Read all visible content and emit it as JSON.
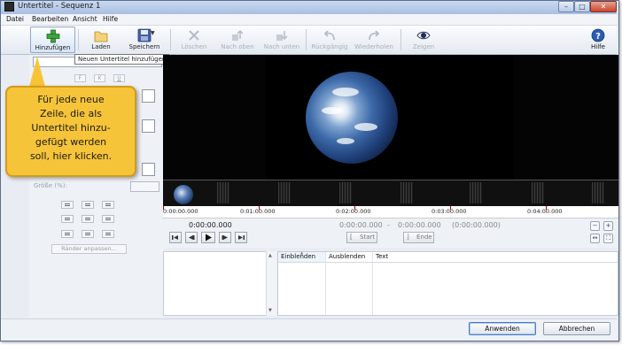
{
  "window": {
    "title": "Untertitel - Sequenz 1",
    "controls": {
      "minimize": "–",
      "maximize": "□",
      "close": "✕"
    }
  },
  "menu": [
    "Datei",
    "Bearbeiten",
    "Ansicht",
    "Hilfe"
  ],
  "toolbar": {
    "add": "Hinzufügen",
    "load": "Laden",
    "save": "Speichern",
    "delete": "Löschen",
    "move_up": "Nach oben",
    "move_down": "Nach unten",
    "undo": "Rückgängig",
    "redo": "Wiederholen",
    "show": "Zeigen",
    "help": "Hilfe"
  },
  "tooltip": "Neuen Untertitel hinzufügen",
  "callout": "Für jede neue\nZeile, die als\nUntertitel hinzu-\ngefügt werden\nsoll, hier klicken.",
  "left_panel": {
    "format_buttons": [
      "F",
      "K",
      "U"
    ],
    "size_label": "Größe (%):",
    "fit_margins": "Ränder anpassen..."
  },
  "timeline": {
    "ruler": [
      "0:00:00.000",
      "0:01:00.000",
      "0:02:00.000",
      "0:03:00.000",
      "0:04:00.000"
    ]
  },
  "transport": {
    "current_time": "0:00:00.000",
    "start_time": "0:00:00.000",
    "dash": "-",
    "end_time": "0:00:00.000",
    "duration": "(0:00:00.000)",
    "start_button": "Start",
    "end_button": "Ende"
  },
  "subtitle_table": {
    "columns": [
      "Einblenden",
      "Ausblenden",
      "Text"
    ]
  },
  "footer": {
    "apply": "Anwenden",
    "cancel": "Abbrechen"
  },
  "colors": {
    "callout": "#f6c438",
    "accent": "#2e8b2e"
  }
}
